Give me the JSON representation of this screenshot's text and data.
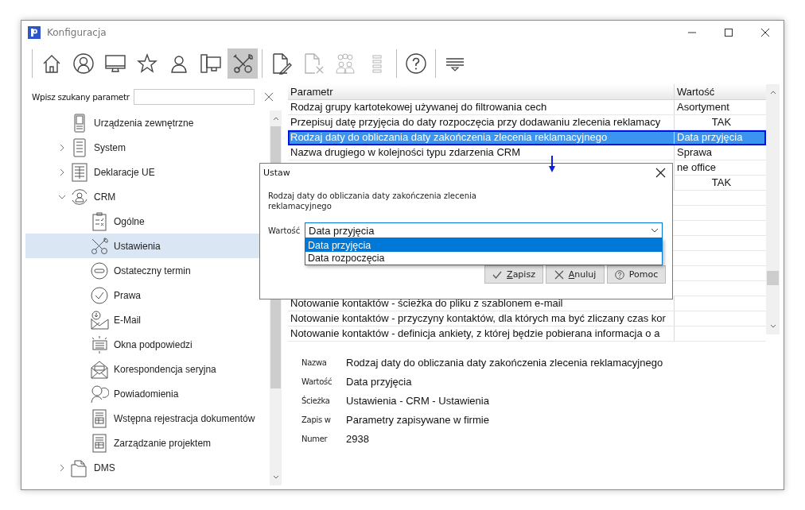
{
  "window": {
    "title": "Konfiguracja"
  },
  "toolbar": {
    "groups": [
      [
        {
          "kind": "home",
          "selected": false,
          "disabled": false
        },
        {
          "kind": "user-circle",
          "selected": false,
          "disabled": false
        },
        {
          "kind": "monitor",
          "selected": false,
          "disabled": false
        },
        {
          "kind": "star",
          "selected": false,
          "disabled": false
        },
        {
          "kind": "person",
          "selected": false,
          "disabled": false
        },
        {
          "kind": "computer",
          "selected": false,
          "disabled": false
        },
        {
          "kind": "tools",
          "selected": true,
          "disabled": false
        }
      ],
      [
        {
          "kind": "doc-edit",
          "selected": false,
          "disabled": false
        },
        {
          "kind": "doc-delete",
          "selected": false,
          "disabled": true
        },
        {
          "kind": "group",
          "selected": false,
          "disabled": true
        },
        {
          "kind": "list",
          "selected": false,
          "disabled": true
        }
      ],
      [
        {
          "kind": "help",
          "selected": false,
          "disabled": false
        }
      ],
      [
        {
          "kind": "filter-menu",
          "selected": false,
          "disabled": false
        }
      ]
    ]
  },
  "search": {
    "label": "Wpisz szukany parametr"
  },
  "tree": {
    "items": [
      {
        "label": "Urządzenia zewnętrzne",
        "kind": "device",
        "selected": false
      },
      {
        "label": "System",
        "kind": "server",
        "expanded": false,
        "selected": false
      },
      {
        "label": "Deklaracje UE",
        "kind": "sheet",
        "expanded": false,
        "selected": false
      },
      {
        "label": "CRM",
        "kind": "crm",
        "expanded": true,
        "selected": false,
        "children": [
          {
            "label": "Ogólne",
            "kind": "checklist",
            "selected": false
          },
          {
            "label": "Ustawienia",
            "kind": "tools",
            "selected": true
          },
          {
            "label": "Ostateczny termin",
            "kind": "minus-circle",
            "selected": false
          },
          {
            "label": "Prawa",
            "kind": "check-circle",
            "selected": false
          },
          {
            "label": "E-Mail",
            "kind": "mail-download",
            "selected": false
          },
          {
            "label": "Okna podpowiedzi",
            "kind": "tooltip",
            "selected": false
          },
          {
            "label": "Korespondencja seryjna",
            "kind": "mail-open",
            "selected": false
          },
          {
            "label": "Powiadomienia",
            "kind": "people",
            "selected": false
          },
          {
            "label": "Wstępna rejestracja dokumentów",
            "kind": "form",
            "selected": false
          },
          {
            "label": "Zarządzanie projektem",
            "kind": "form",
            "selected": false
          }
        ]
      },
      {
        "label": "DMS",
        "kind": "folders",
        "expanded": false,
        "selected": false
      }
    ]
  },
  "table": {
    "columns": [
      "Parametr",
      "Wartość"
    ],
    "rows": [
      {
        "parameter": "Rodzaj grupy kartotekowej używanej do filtrowania cech",
        "value": "Asortyment",
        "kind": "text",
        "selected": false
      },
      {
        "parameter": "Przepisuj datę przyjęcia do daty rozpoczęcia przy dodawaniu zlecenia reklamacy",
        "value": "TAK",
        "kind": "flag",
        "selected": false
      },
      {
        "parameter": "Rodzaj daty do obliczania daty zakończenia zlecenia reklamacyjnego",
        "value": "Data przyjęcia",
        "kind": "text",
        "selected": true
      },
      {
        "parameter": "Nazwa drugiego w kolejności typu zdarzenia CRM",
        "value": "Sprawa",
        "kind": "text",
        "selected": false
      },
      {
        "value": "ne office",
        "kind": "text",
        "selected": false
      },
      {
        "value": "TAK",
        "kind": "flag",
        "selected": false
      }
    ],
    "rows_lower": [
      {
        "parameter": "Notowanie kontaktów - ścieżka do pliku z szablonem e-mail",
        "selected": false
      },
      {
        "parameter": "Notowanie kontaktów - przyczyny kontaktów, dla których ma być zliczany czas kor",
        "selected": false
      },
      {
        "parameter": "Notowanie kontaktów - definicja ankiety, z której będzie pobierana informacja o a",
        "selected": false
      }
    ]
  },
  "dialog": {
    "title": "Ustaw",
    "description": "Rodzaj daty do obliczania daty zakończenia zlecenia reklamacyjnego",
    "field_label": "Wartość",
    "value": "Data przyjęcia",
    "options": [
      {
        "label": "Data przyjęcia",
        "selected": true
      },
      {
        "label": "Data rozpoczęcia",
        "selected": false
      }
    ],
    "buttons": [
      {
        "label": "Zapisz",
        "kind": "save",
        "mnemonic": true
      },
      {
        "label": "Anuluj",
        "kind": "cancel",
        "mnemonic": true
      },
      {
        "label": "Pomoc",
        "kind": "help",
        "mnemonic": false
      }
    ]
  },
  "details": [
    {
      "label": "Nazwa",
      "value": "Rodzaj daty do obliczania daty zakończenia zlecenia reklamacyjnego"
    },
    {
      "label": "Wartość",
      "value": "Data przyjęcia"
    },
    {
      "label": "Ścieżka",
      "value": "Ustawienia - CRM - Ustawienia"
    },
    {
      "label": "Zapis w",
      "value": "Parametry zapisywane w firmie"
    },
    {
      "label": "Numer",
      "value": "2938"
    }
  ]
}
